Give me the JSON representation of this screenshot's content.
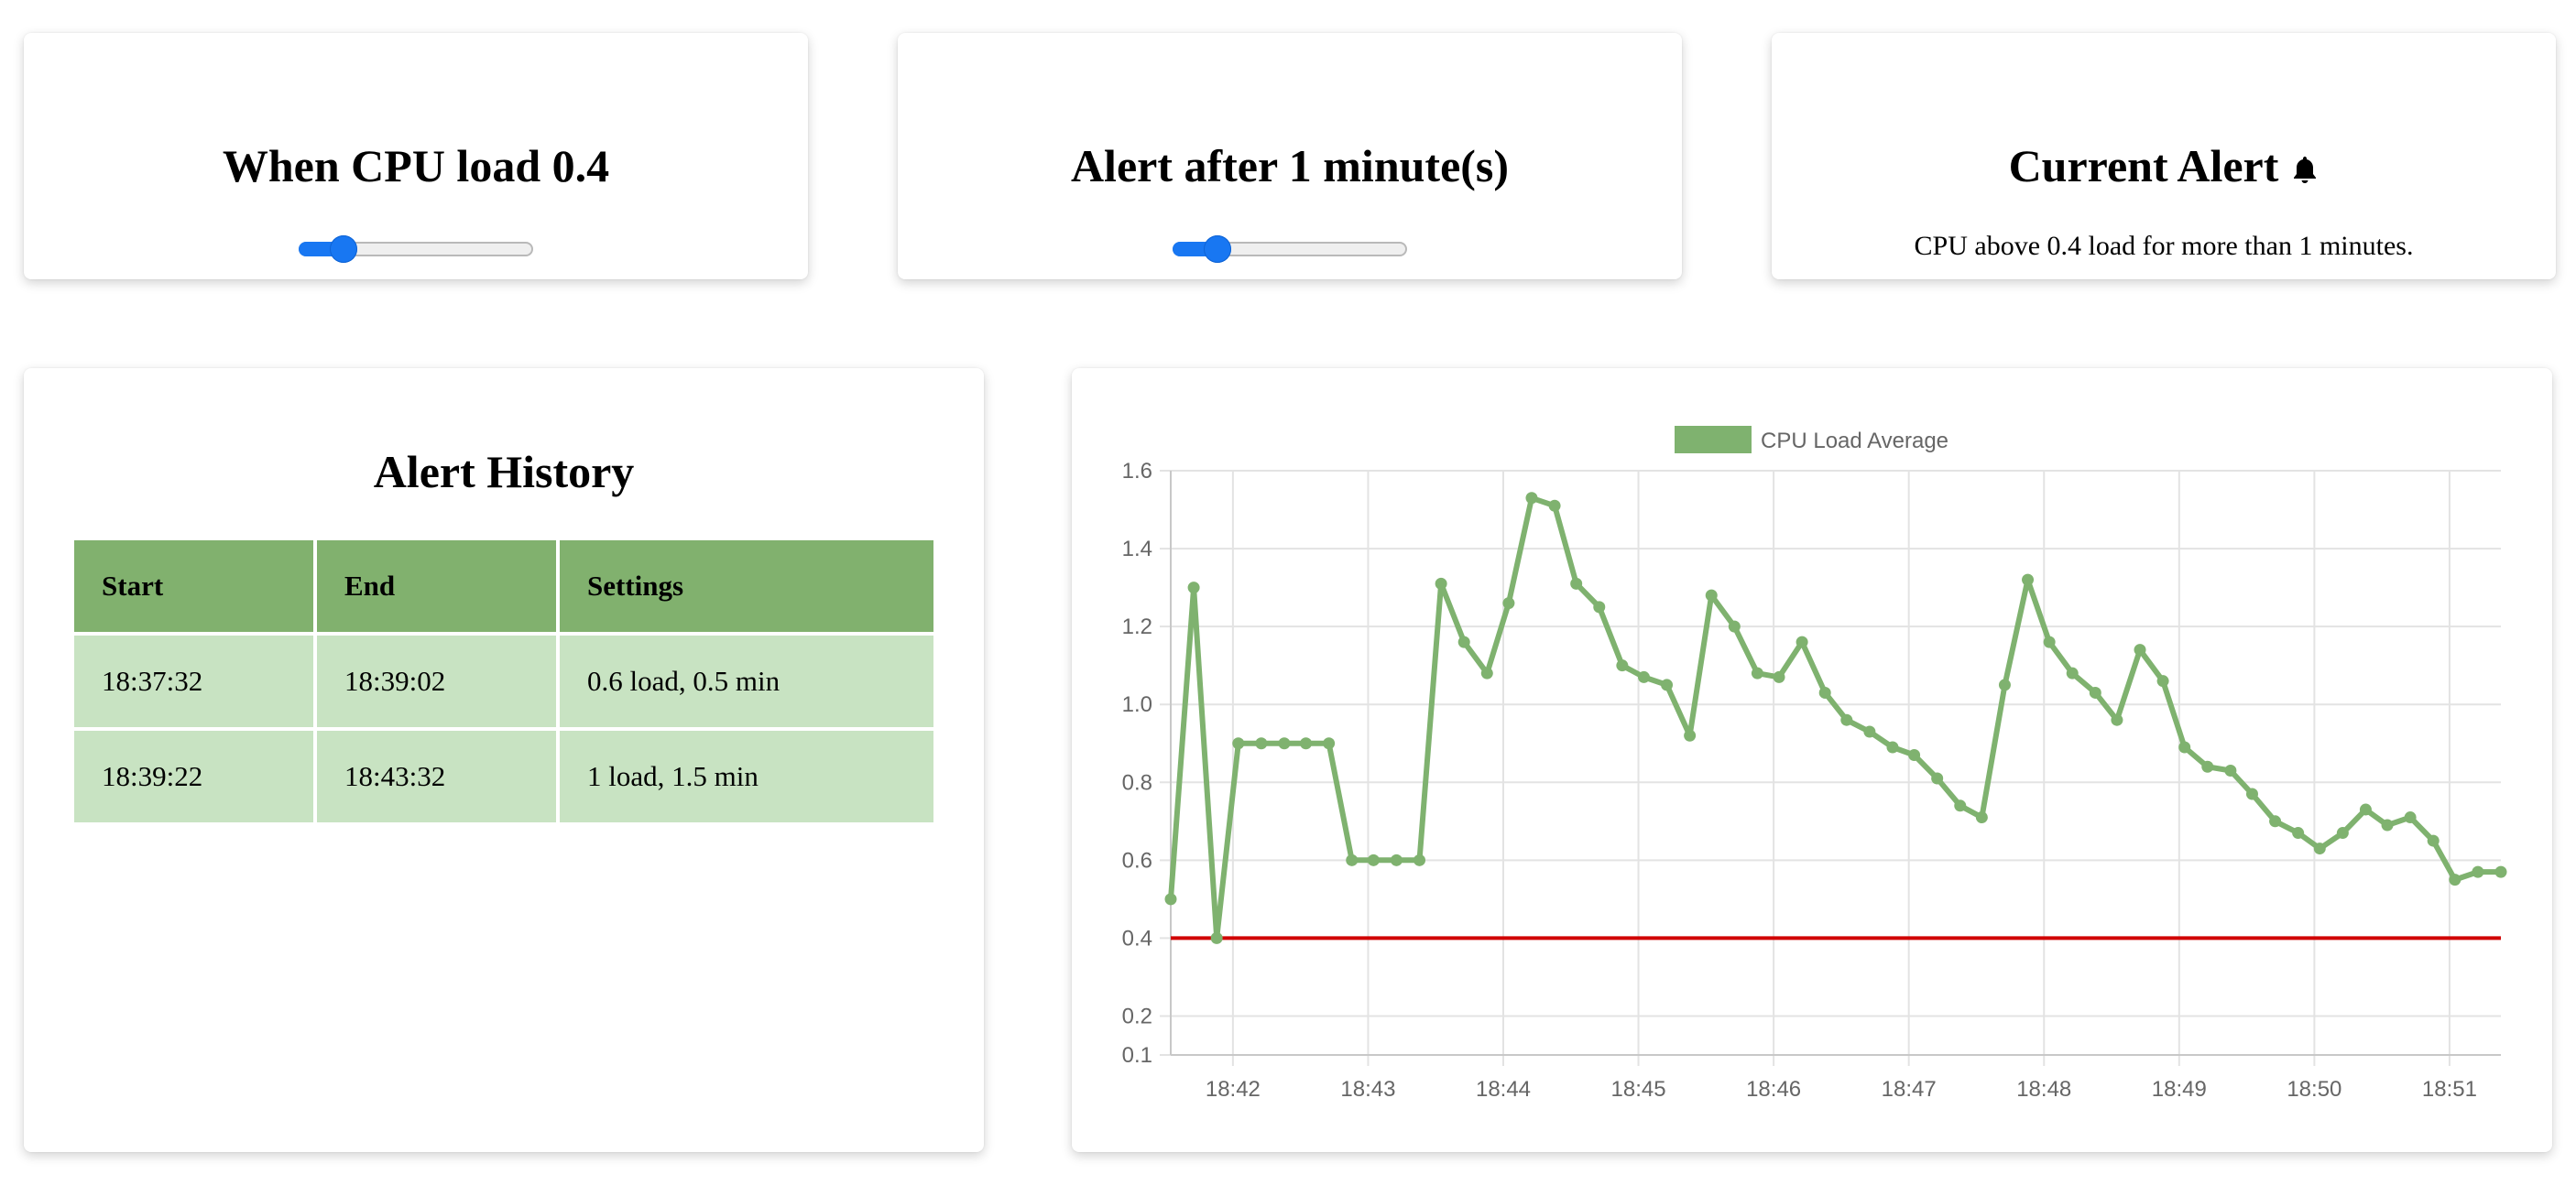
{
  "threshold_card": {
    "title": "When CPU load 0.4",
    "slider_value": 0.4,
    "slider_fraction": 0.19
  },
  "duration_card": {
    "title": "Alert after 1 minute(s)",
    "slider_value": 1,
    "slider_fraction": 0.19
  },
  "alert_card": {
    "title": "Current Alert",
    "icon": "bell-icon",
    "message": "CPU above 0.4 load for more than 1 minutes."
  },
  "history_card": {
    "title": "Alert History",
    "columns": [
      "Start",
      "End",
      "Settings"
    ],
    "rows": [
      [
        "18:37:32",
        "18:39:02",
        "0.6 load, 0.5 min"
      ],
      [
        "18:39:22",
        "18:43:32",
        "1 load, 1.5 min"
      ]
    ]
  },
  "colors": {
    "accent": "#1877f2",
    "header_green": "#81b16e",
    "row_green": "#c8e3c2",
    "series_green": "#7fb26f",
    "threshold_red": "#d10000"
  },
  "chart_data": {
    "type": "line",
    "legend": "CPU Load Average",
    "legend_position": "top",
    "grid": true,
    "ylim": [
      0.1,
      1.6
    ],
    "y_ticks": [
      0.1,
      0.2,
      0.4,
      0.6,
      0.8,
      1.0,
      1.2,
      1.4,
      1.6
    ],
    "y_tick_labels": [
      "0.1",
      "0.2",
      "0.4",
      "0.6",
      "0.8",
      "1.0",
      "1.2",
      "1.4",
      "1.6"
    ],
    "x_tick_labels": [
      "18:42",
      "18:43",
      "18:44",
      "18:45",
      "18:46",
      "18:47",
      "18:48",
      "18:49",
      "18:50",
      "18:51"
    ],
    "x_range_minutes": [
      41.54,
      51.38
    ],
    "threshold": 0.4,
    "series": [
      {
        "name": "CPU Load Average",
        "x": [
          41.54,
          41.71,
          41.88,
          42.04,
          42.21,
          42.38,
          42.54,
          42.71,
          42.88,
          43.04,
          43.21,
          43.38,
          43.54,
          43.71,
          43.88,
          44.04,
          44.21,
          44.38,
          44.54,
          44.71,
          44.88,
          45.04,
          45.21,
          45.38,
          45.54,
          45.71,
          45.88,
          46.04,
          46.21,
          46.38,
          46.54,
          46.71,
          46.88,
          47.04,
          47.21,
          47.38,
          47.54,
          47.71,
          47.88,
          48.04,
          48.21,
          48.38,
          48.54,
          48.71,
          48.88,
          49.04,
          49.21,
          49.38,
          49.54,
          49.71,
          49.88,
          50.04,
          50.21,
          50.38,
          50.54,
          50.71,
          50.88,
          51.04,
          51.21,
          51.38
        ],
        "y": [
          0.5,
          1.3,
          0.4,
          0.9,
          0.9,
          0.9,
          0.9,
          0.9,
          0.6,
          0.6,
          0.6,
          0.6,
          1.31,
          1.16,
          1.08,
          1.26,
          1.53,
          1.51,
          1.31,
          1.25,
          1.1,
          1.07,
          1.05,
          0.92,
          1.28,
          1.2,
          1.08,
          1.07,
          1.16,
          1.03,
          0.96,
          0.93,
          0.89,
          0.87,
          0.81,
          0.74,
          0.71,
          1.05,
          1.32,
          1.16,
          1.08,
          1.03,
          0.96,
          1.14,
          1.06,
          0.89,
          0.84,
          0.83,
          0.77,
          0.7,
          0.67,
          0.63,
          0.67,
          0.73,
          0.69,
          0.71,
          0.65,
          0.55,
          0.57,
          0.57
        ]
      }
    ]
  }
}
